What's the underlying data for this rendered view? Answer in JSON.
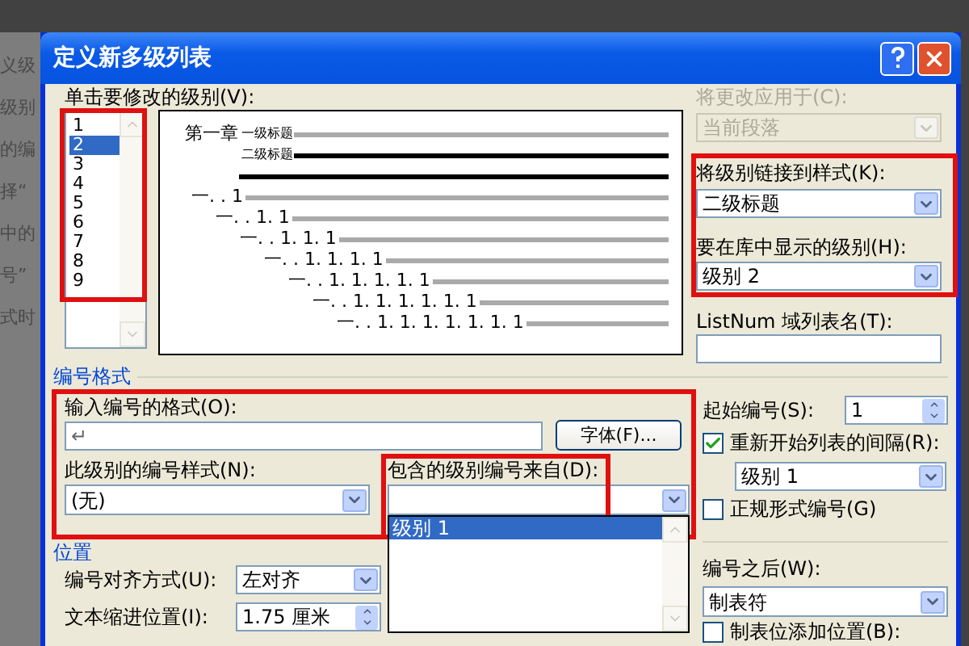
{
  "background_text": [
    "义级",
    "级别",
    "的编",
    "择“",
    "中的",
    "号”",
    "式时"
  ],
  "window": {
    "title": "定义新多级列表"
  },
  "level_list": {
    "label": "单击要修改的级别(V):",
    "items": [
      {
        "text": "1",
        "selected": false
      },
      {
        "text": "2",
        "selected": true
      },
      {
        "text": "3",
        "selected": false
      },
      {
        "text": "4",
        "selected": false
      },
      {
        "text": "5",
        "selected": false
      },
      {
        "text": "6",
        "selected": false
      },
      {
        "text": "7",
        "selected": false
      },
      {
        "text": "8",
        "selected": false
      },
      {
        "text": "9",
        "selected": false
      }
    ]
  },
  "preview": {
    "rows": [
      {
        "label": "第一章",
        "sub": "一级标题",
        "selected": false
      },
      {
        "sub": "二级标题",
        "selected": true
      },
      {
        "selected": true
      },
      {
        "label": "一. . 1",
        "selected": false
      },
      {
        "label": "一. . 1. 1",
        "selected": false
      },
      {
        "label": "一. . 1. 1. 1",
        "selected": false
      },
      {
        "label": "一. . 1. 1. 1. 1",
        "selected": false
      },
      {
        "label": "一. . 1. 1. 1. 1. 1",
        "selected": false
      },
      {
        "label": "一. . 1. 1. 1. 1. 1. 1",
        "selected": false
      },
      {
        "label": "一. . 1. 1. 1. 1. 1. 1. 1",
        "selected": false
      }
    ]
  },
  "apply_to": {
    "label": "将更改应用于(C):",
    "value": "当前段落",
    "disabled": true
  },
  "link_style": {
    "label": "将级别链接到样式(K):",
    "value": "二级标题"
  },
  "gallery_level": {
    "label": "要在库中显示的级别(H):",
    "value": "级别 2"
  },
  "listnum": {
    "label": "ListNum 域列表名(T):"
  },
  "number_format": {
    "title": "编号格式",
    "format_label": "输入编号的格式(O):",
    "format_value": "↵",
    "font_button": "字体(F)...",
    "style_label": "此级别的编号样式(N):",
    "style_value": "(无)",
    "include_label": "包含的级别编号来自(D):",
    "include_options": [
      {
        "text": "级别 1",
        "selected": true
      }
    ]
  },
  "start_at": {
    "label": "起始编号(S):",
    "value": "1"
  },
  "restart": {
    "label": "重新开始列表的间隔(R):",
    "checked": true,
    "value": "级别 1"
  },
  "legal": {
    "label": "正规形式编号(G)",
    "checked": false
  },
  "position": {
    "title": "位置",
    "align_label": "编号对齐方式(U):",
    "align_value": "左对齐",
    "indent_label": "文本缩进位置(I):",
    "indent_value": "1.75 厘米"
  },
  "follow": {
    "label": "编号之后(W):",
    "value": "制表符"
  },
  "tab_stop": {
    "label": "制表位添加位置(B):",
    "checked": false
  }
}
